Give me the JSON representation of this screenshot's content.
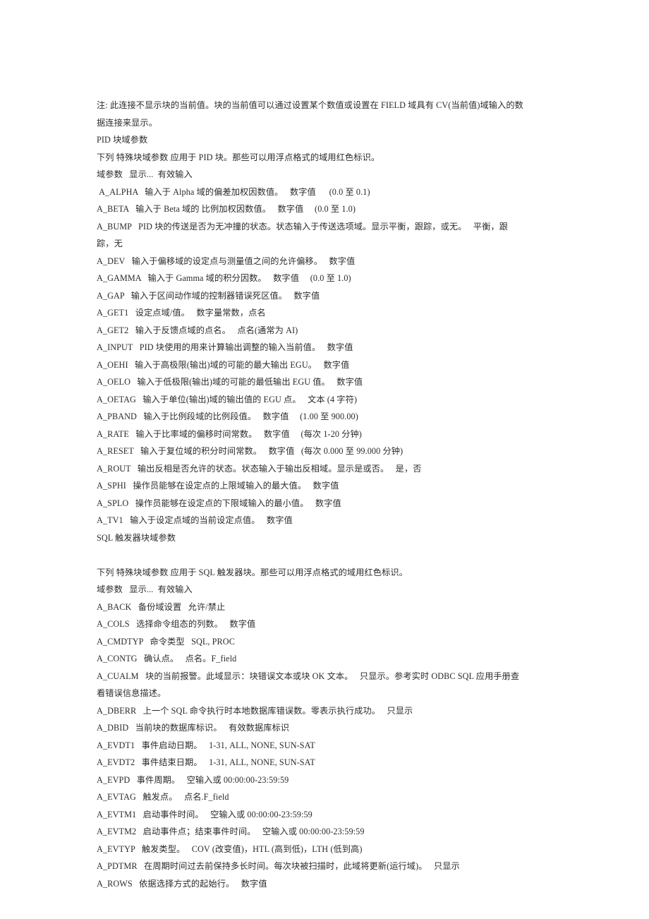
{
  "document": {
    "note_line": "注: 此连接不显示块的当前值。块的当前值可以通过设置某个数值或设置在 FIELD 域具有 CV(当前值)域输入的数据连接来显示。",
    "sections": [
      {
        "heading": "PID 块域参数",
        "intro": "下列 特殊块域参数 应用于 PID 块。那些可以用浮点格式的域用红色标识。",
        "column_header": "域参数   显示...  有效输入",
        "blank_after_heading": false,
        "rows": [
          " A_ALPHA   输入于 Alpha 域的偏差加权因数值。   数字值      (0.0 至 0.1)",
          "A_BETA   输入于 Beta 域的 比例加权因数值。   数字值     (0.0 至 1.0)",
          "A_BUMP   PID 块的传送是否为无冲撞的状态。状态输入于传送选项域。显示平衡，跟踪，或无。   平衡，跟踪，无",
          "A_DEV   输入于偏移域的设定点与测量值之间的允许偏移。   数字值",
          "A_GAMMA   输入于 Gamma 域的积分因数。   数字值     (0.0 至 1.0)",
          "A_GAP   输入于区间动作域的控制器错误死区值。   数字值",
          "A_GET1   设定点域/值。   数字量常数，点名",
          "A_GET2   输入于反馈点域的点名。   点名(通常为 AI)",
          "A_INPUT   PID 块使用的用来计算输出调整的输入当前值。   数字值",
          "A_OEHI   输入于高极限(输出)域的可能的最大输出 EGU。   数字值",
          "A_OELO   输入于低极限(输出)域的可能的最低输出 EGU 值。   数字值",
          "A_OETAG   输入于单位(输出)域的输出值的 EGU 点。   文本 (4 字符)",
          "A_PBAND   输入于比例段域的比例段值。   数字值     (1.00 至 900.00)",
          "A_RATE   输入于比率域的偏移时间常数。   数字值     (每次 1-20 分钟)",
          "A_RESET   输入于复位域的积分时间常数。   数字值   (每次 0.000 至 99.000 分钟)",
          "A_ROUT   输出反相是否允许的状态。状态输入于输出反相域。显示是或否。   是，否",
          "A_SPHI   操作员能够在设定点的上限域输入的最大值。   数字值",
          "A_SPLO   操作员能够在设定点的下限域输入的最小值。   数字值",
          "A_TV1   输入于设定点域的当前设定点值。   数字值"
        ]
      },
      {
        "heading": "SQL 触发器块域参数",
        "intro": "下列 特殊块域参数 应用于 SQL 触发器块。那些可以用浮点格式的域用红色标识。",
        "column_header": "域参数   显示...  有效输入",
        "blank_after_heading": true,
        "rows": [
          "A_BACK   备份域设置   允许/禁止",
          "A_COLS   选择命令组态的列数。   数字值",
          "A_CMDTYP   命令类型   SQL, PROC",
          "A_CONTG   确认点。   点名。F_field",
          "A_CUALM   块的当前报警。此域显示：块错误文本或块 OK 文本。   只显示。参考实时 ODBC SQL 应用手册查看错误信息描述。",
          "A_DBERR   上一个 SQL 命令执行时本地数据库错误数。零表示执行成功。   只显示",
          "A_DBID   当前块的数据库标识。   有效数据库标识",
          "A_EVDT1   事件启动日期。   1-31, ALL, NONE, SUN-SAT",
          "A_EVDT2   事件结束日期。   1-31, ALL, NONE, SUN-SAT",
          "A_EVPD   事件周期。   空输入或 00:00:00-23:59:59",
          "A_EVTAG   触发点。   点名.F_field",
          "A_EVTM1   启动事件时间。   空输入或 00:00:00-23:59:59",
          "A_EVTM2   启动事件点；结束事件时间。   空输入或 00:00:00-23:59:59",
          "A_EVTYP   触发类型。   COV (改变值)，HTL (高到低)，LTH (低到高)",
          "A_PDTMR   在周期时间过去前保持多长时间。每次块被扫描时，此域将更新(运行域)。   只显示",
          "A_ROWS   依据选择方式的起始行。   数字值"
        ]
      }
    ]
  }
}
